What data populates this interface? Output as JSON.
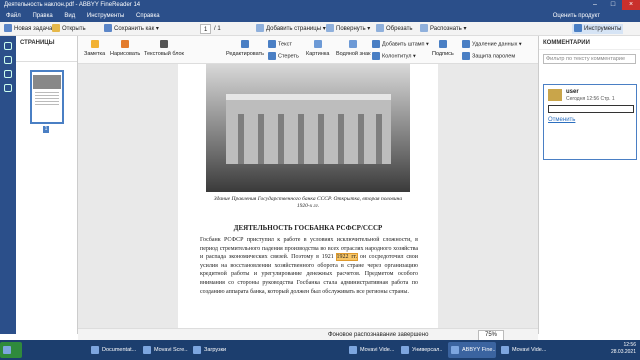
{
  "window": {
    "title": "Деятельность наклон.pdf - ABBYY FineReader 14"
  },
  "menu": {
    "items": [
      "Файл",
      "Правка",
      "Вид",
      "Инструменты",
      "Справка"
    ],
    "rate": "Оценить продукт"
  },
  "controls": {
    "new_task": "Новая задача",
    "open": "Открыть",
    "save_as": "Сохранить как",
    "page_current": "1",
    "page_total": "/ 1",
    "add_pages": "Добавить страницы",
    "rotate": "Повернуть",
    "crop": "Обрезать",
    "recognize": "Распознать",
    "tools": "Инструменты"
  },
  "ribbon": {
    "note": "Заметка",
    "draw": "Нарисовать",
    "textbox": "Текстовый блок",
    "edit": "Редактировать",
    "text": "Текст",
    "erase": "Стереть",
    "picture": "Картинка",
    "watermark": "Водяной знак",
    "header_footer": "Колонтитул",
    "add_stamp": "Добавить штамп",
    "signature": "Подпись",
    "delete_data": "Удаление данных",
    "protect": "Защита паролем"
  },
  "pages_panel": {
    "title": "СТРАНИЦЫ",
    "page_label": "1"
  },
  "document": {
    "caption": "Здание Правления Государственного банка СССР. Открытка, вторая половина 1920-х гг.",
    "heading": "ДЕЯТЕЛЬНОСТЬ ГОСБАНКА РСФСР/СССР",
    "para_before": "Госбанк РСФСР приступил к работе в условиях исключительной сложности, в период стремительного падения производства во всех отраслях народного хозяйства и распада экономических связей. Поэтому в 1921 ",
    "highlight": "1922 гг.",
    "para_after": " он сосредоточил свои усилия на восстановлении хозяйственного оборота в стране через организацию кредитной работы и урегулирование денежных расчетов. Предметом особого внимания со стороны руководства Госбанка стала административная работа по созданию аппарата банка, который должен был обслуживать все регионы страны."
  },
  "comments": {
    "title": "КОММЕНТАРИИ",
    "filter_placeholder": "Фильтр по тексту комментарие",
    "user": "user",
    "date": "Сегодня 12:56",
    "page": "Стр. 1",
    "cancel": "Отменить"
  },
  "status": {
    "message": "Фоновое распознавание завершено",
    "zoom": "75%"
  },
  "taskbar": {
    "items": [
      "Documentat...",
      "Movavi Scre...",
      "Загрузки",
      "Movavi Vide...",
      "Универсал..",
      "ABBYY Fine...",
      "Movavi Vide..."
    ],
    "time": "12:56",
    "date": "28.03.2021"
  },
  "colors": {
    "title_bar": "#2b4f8a",
    "accent": "#4a7fc4",
    "highlight": "#f7c566"
  }
}
